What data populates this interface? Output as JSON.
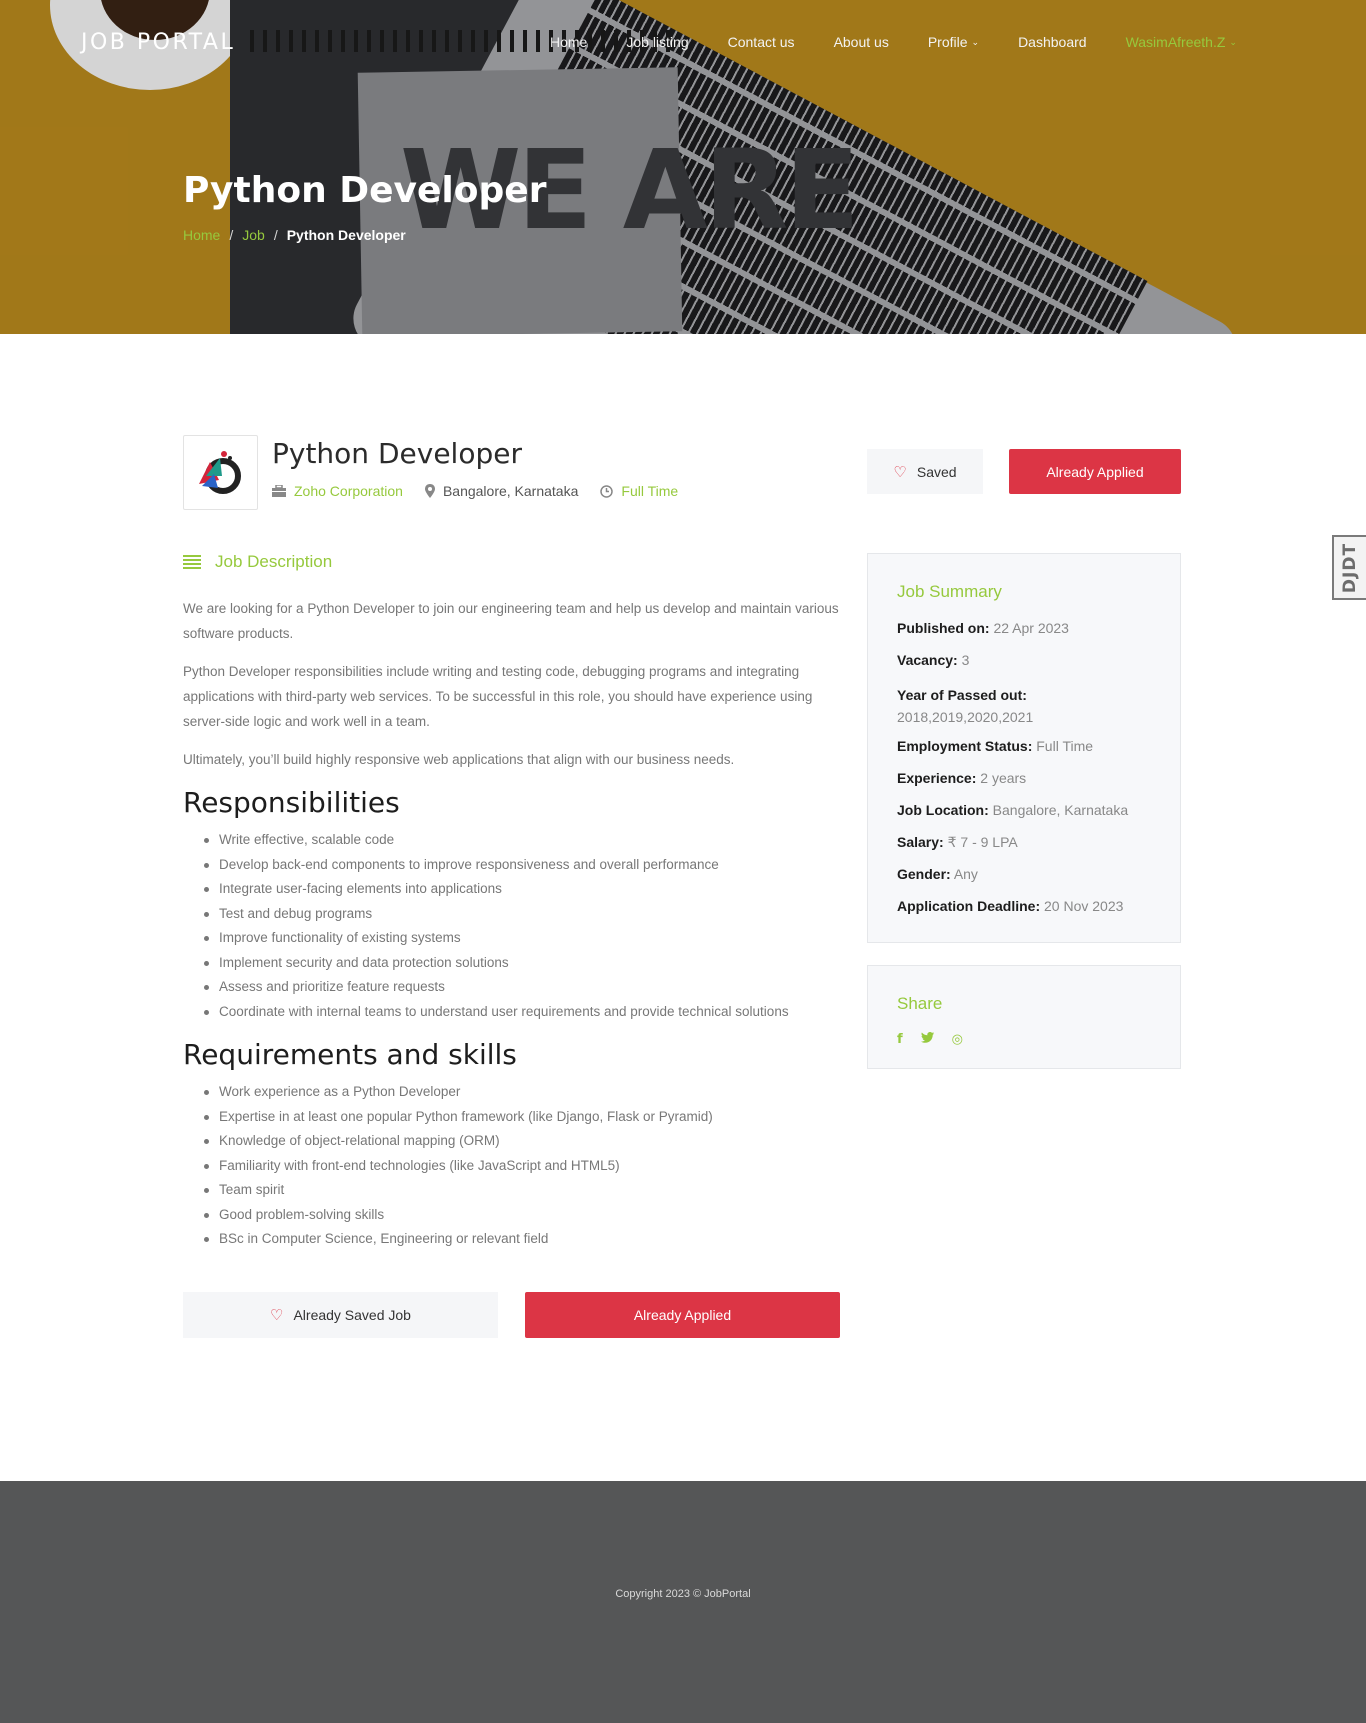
{
  "nav": {
    "brand": "JOB PORTAL",
    "items": [
      {
        "label": "Home"
      },
      {
        "label": "Job listing"
      },
      {
        "label": "Contact us"
      },
      {
        "label": "About us"
      },
      {
        "label": "Profile"
      },
      {
        "label": "Dashboard"
      },
      {
        "label": "WasimAfreeth.Z"
      }
    ]
  },
  "hero": {
    "title": "Python Developer",
    "pad_text": "WE ARE",
    "breadcrumb": {
      "home": "Home",
      "sep": "/",
      "job": "Job",
      "current": "Python Developer"
    }
  },
  "job": {
    "title": "Python Developer",
    "company": "Zoho Corporation",
    "location": "Bangalore, Karnataka",
    "type": "Full Time",
    "saved_label": "Saved",
    "applied_label": "Already Applied"
  },
  "description": {
    "heading": "Job Description",
    "paragraphs": [
      "We are looking for a Python Developer to join our engineering team and help us develop and maintain various software products.",
      "Python Developer responsibilities include writing and testing code, debugging programs and integrating applications with third-party web services. To be successful in this role, you should have experience using server-side logic and work well in a team.",
      "Ultimately, you’ll build highly responsive web applications that align with our business needs."
    ],
    "responsibilities_heading": "Responsibilities",
    "responsibilities": [
      "Write effective, scalable code",
      "Develop back-end components to improve responsiveness and overall performance",
      "Integrate user-facing elements into applications",
      "Test and debug programs",
      "Improve functionality of existing systems",
      "Implement security and data protection solutions",
      "Assess and prioritize feature requests",
      "Coordinate with internal teams to understand user requirements and provide technical solutions"
    ],
    "requirements_heading": "Requirements and skills",
    "requirements": [
      "Work experience as a Python Developer",
      "Expertise in at least one popular Python framework (like Django, Flask or Pyramid)",
      "Knowledge of object-relational mapping (ORM)",
      "Familiarity with front-end technologies (like JavaScript and HTML5)",
      "Team spirit",
      "Good problem-solving skills",
      "BSc in Computer Science, Engineering or relevant field"
    ],
    "saved_job_label": "Already Saved Job",
    "applied_label": "Already Applied"
  },
  "summary": {
    "title": "Job Summary",
    "rows": [
      {
        "label": "Published on:",
        "value": "22 Apr 2023"
      },
      {
        "label": "Vacancy:",
        "value": "3"
      },
      {
        "label": "Year of Passed out:",
        "value": "2018,2019,2020,2021"
      },
      {
        "label": "Employment Status:",
        "value": "Full Time"
      },
      {
        "label": "Experience:",
        "value": "2 years"
      },
      {
        "label": "Job Location:",
        "value": "Bangalore, Karnataka"
      },
      {
        "label": "Salary:",
        "value": "₹ 7 - 9 LPA"
      },
      {
        "label": "Gender:",
        "value": "Any"
      },
      {
        "label": "Application Deadline:",
        "value": "20 Nov 2023"
      }
    ]
  },
  "share": {
    "title": "Share",
    "icons": [
      {
        "name": "facebook-icon",
        "glyph": "f"
      },
      {
        "name": "twitter-icon",
        "glyph": "t"
      },
      {
        "name": "instagram-icon",
        "glyph": "◎"
      }
    ]
  },
  "side_tab": {
    "label": "DJDT"
  },
  "footer": {
    "copyright": "Copyright 2023 © JobPortal"
  },
  "colors": {
    "accent": "#96c93d",
    "danger": "#dc3545",
    "footer": "#555657"
  }
}
